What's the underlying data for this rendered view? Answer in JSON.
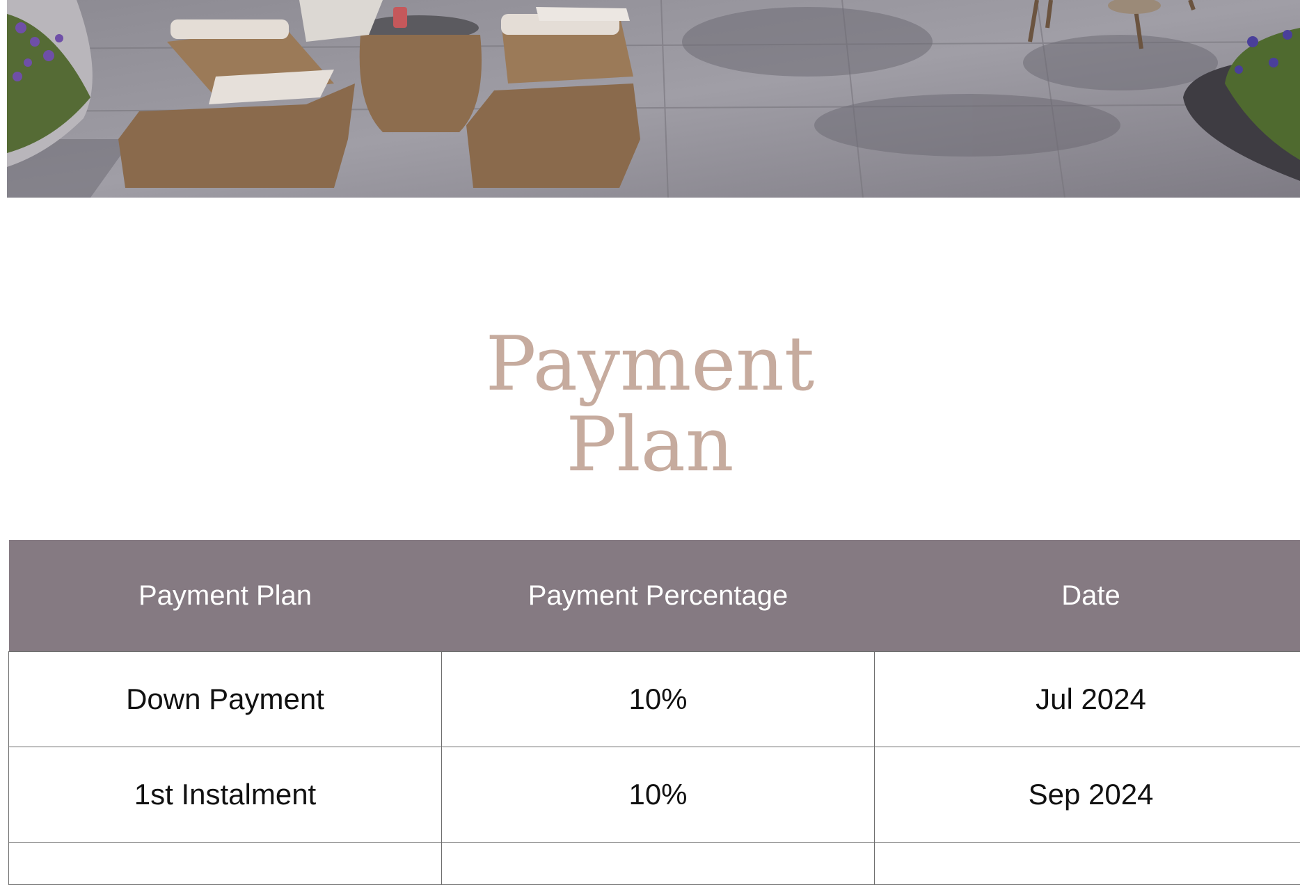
{
  "hero": {
    "image": "outdoor-terrace-with-wicker-loungers"
  },
  "title": {
    "line1": "Payment",
    "line2": "Plan"
  },
  "table": {
    "headers": [
      "Payment Plan",
      "Payment Percentage",
      "Date"
    ],
    "rows": [
      [
        "Down Payment",
        "10%",
        "Jul 2024"
      ],
      [
        "1st Instalment",
        "10%",
        "Sep 2024"
      ],
      [
        "",
        "",
        ""
      ]
    ]
  },
  "colors": {
    "title": "#c6ab9e",
    "header_bg": "#857a82",
    "header_text": "#ffffff",
    "border": "#6d6d6d"
  }
}
